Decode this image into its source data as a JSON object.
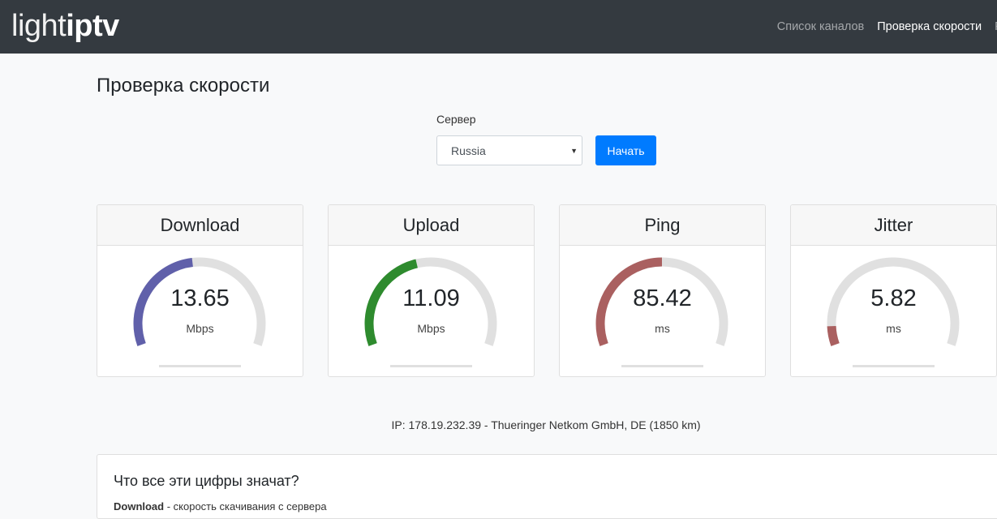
{
  "brand": {
    "light": "light",
    "iptv": "iptv"
  },
  "nav": [
    {
      "label": "Список каналов",
      "active": false
    },
    {
      "label": "Проверка скорости",
      "active": true
    },
    {
      "label": "F",
      "active": false
    }
  ],
  "page_title": "Проверка скорости",
  "server": {
    "label": "Сервер",
    "selected": "Russia"
  },
  "start_button": "Начать",
  "gauges": [
    {
      "title": "Download",
      "value": "13.65",
      "unit": "Mbps",
      "fraction": 0.47,
      "color": "#6060aa"
    },
    {
      "title": "Upload",
      "value": "11.09",
      "unit": "Mbps",
      "fraction": 0.44,
      "color": "#2e8b2e"
    },
    {
      "title": "Ping",
      "value": "85.42",
      "unit": "ms",
      "fraction": 0.5,
      "color": "#aa6060"
    },
    {
      "title": "Jitter",
      "value": "5.82",
      "unit": "ms",
      "fraction": 0.08,
      "color": "#aa6060"
    }
  ],
  "gauge_track_color": "#e0e0e0",
  "ip_info": "IP: 178.19.232.39 - Thueringer Netkom GmbH, DE (1850 km)",
  "info": {
    "title": "Что все эти цифры значат?",
    "term": "Download",
    "description": " - скорость скачивания с сервера"
  }
}
